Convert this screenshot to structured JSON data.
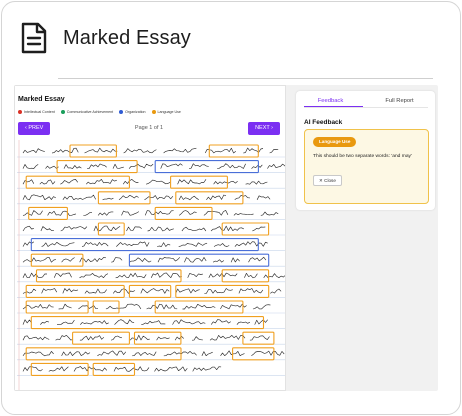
{
  "page": {
    "title": "Marked Essay",
    "icon": "document-icon"
  },
  "essay": {
    "title": "Marked Essay",
    "legend": [
      {
        "label": "Intellectual Content",
        "color": "#d93025"
      },
      {
        "label": "Communicative Achievement",
        "color": "#1a9e5b"
      },
      {
        "label": "Organization",
        "color": "#2f5bd3"
      },
      {
        "label": "Language Use",
        "color": "#e9990f"
      }
    ],
    "pager": {
      "prev_label": "‹ PREV",
      "page_label": "Page 1 of 1",
      "next_label": "NEXT ›"
    }
  },
  "feedback": {
    "tabs": [
      {
        "label": "Feedback",
        "active": true
      },
      {
        "label": "Full Report",
        "active": false
      }
    ],
    "heading": "AI Feedback",
    "item": {
      "category": "Language Use",
      "category_color": "#e9990f",
      "text": "This should be two separate words: 'and may'",
      "close_label": "✕ Close"
    }
  }
}
